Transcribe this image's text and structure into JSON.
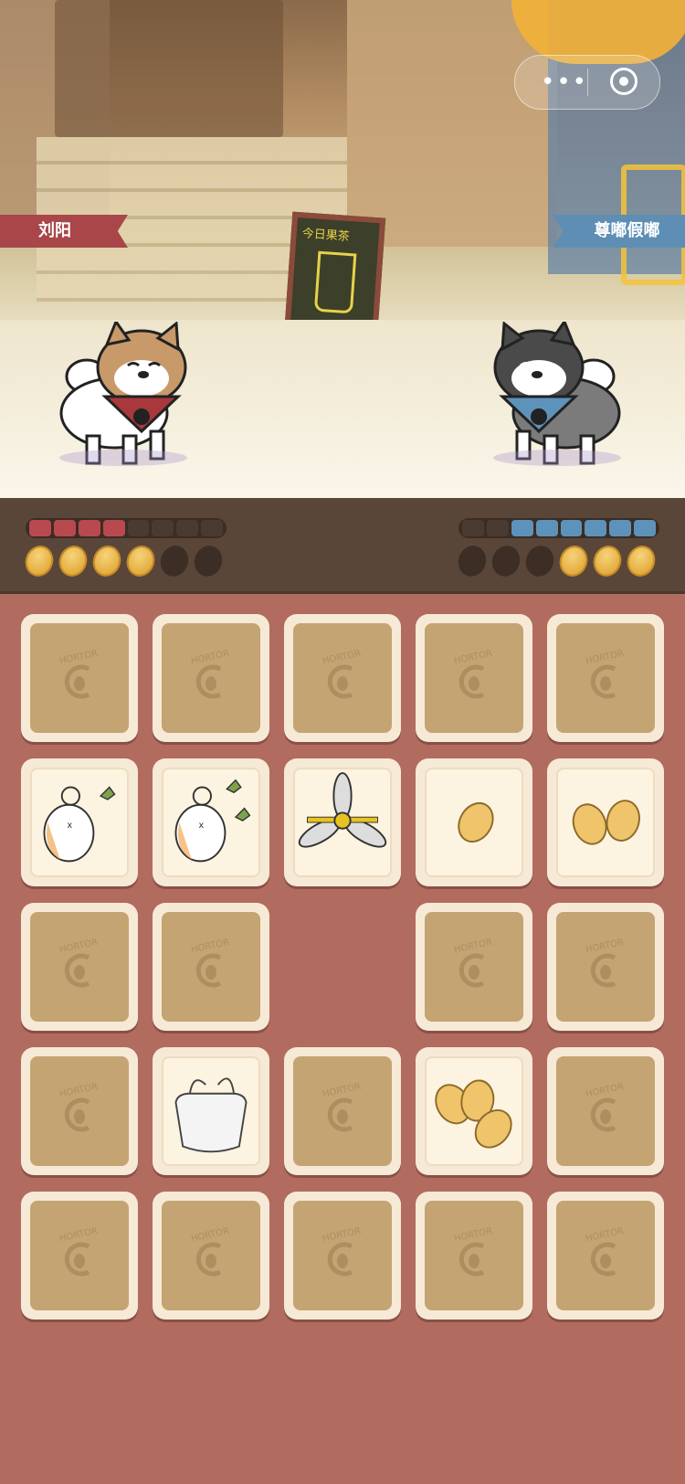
{
  "players": {
    "left": {
      "name": "刘阳",
      "health": {
        "filled": 4,
        "total": 8
      },
      "beans": {
        "filled": 4,
        "total": 6
      }
    },
    "right": {
      "name": "尊嘟假嘟",
      "health": {
        "filled": 6,
        "total": 8
      },
      "beans": {
        "filled": 3,
        "total": 6
      }
    }
  },
  "scene": {
    "chalkboard_text": "今日果茶"
  },
  "card_back_logo": "HORTOR",
  "colors": {
    "background": "#b26b5f",
    "status_bar": "#5a4639",
    "left_health": "#b8494e",
    "right_health": "#5d93bb",
    "bean": "#e2a939"
  },
  "grid": {
    "rows": [
      [
        "back",
        "back",
        "back",
        "back",
        "back"
      ],
      [
        "dog-butt-fart",
        "dog-butt-fart-double",
        "fan",
        "bean-one",
        "bean-two"
      ],
      [
        "back",
        "back",
        "empty",
        "back",
        "back"
      ],
      [
        "back",
        "plastic-bag",
        "back",
        "bean-three",
        "back"
      ],
      [
        "back",
        "back",
        "back",
        "back",
        "back"
      ]
    ]
  }
}
